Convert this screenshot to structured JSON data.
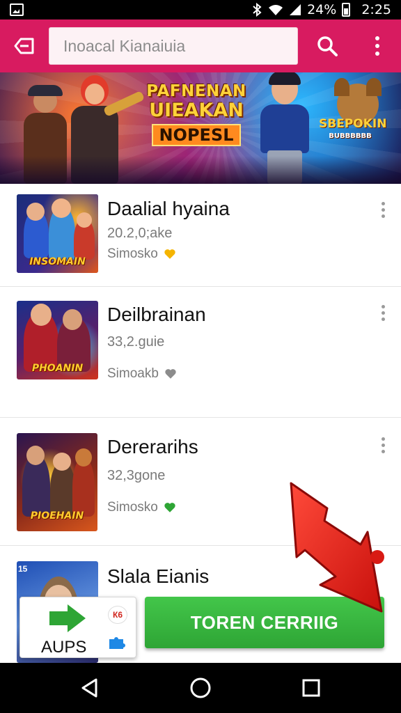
{
  "status_bar": {
    "battery_percent": "24%",
    "time": "2:25",
    "icons": [
      "image-icon",
      "bluetooth-icon",
      "wifi-icon",
      "signal-icon",
      "battery-icon"
    ]
  },
  "app_bar": {
    "background_color": "#d81b60",
    "search_placeholder": "Inoacal Kianaiuia",
    "icons": [
      "back-icon",
      "search-icon",
      "more-vert-icon"
    ]
  },
  "banner": {
    "title_line1": "PAFNENAN",
    "title_line2": "UIEAKAN",
    "title_line3": "NOPESL",
    "badge_title": "SBEPOKIN",
    "badge_subtitle": "BUBBBBBB",
    "page_count": 4
  },
  "list": {
    "items": [
      {
        "title": "Daalial hyaina",
        "meta": "20.2,0;ake",
        "sub": "Simosko",
        "thumb_caption": "INSOMAIN",
        "heart_color": "#f5b400",
        "icon": "heart-icon"
      },
      {
        "title": "Deilbrainan",
        "meta": "33,2.guie",
        "sub": "Simoakb",
        "thumb_caption": "PHOANIN",
        "heart_color": "#8c8c8c",
        "icon": "heart-icon"
      },
      {
        "title": "Dererarihs",
        "meta": "32,3gone",
        "sub": "Simosko",
        "thumb_caption": "PIOEHAIN",
        "heart_color": "#2ea535",
        "icon": "heart-icon"
      },
      {
        "title": "Slala Eianis",
        "thumb_corner": "15"
      }
    ]
  },
  "bottom": {
    "apps_label": "AUPS",
    "badge_text": "К6",
    "cta_label": "TOREN CERRIIG",
    "cta_color": "#2ea535"
  },
  "nav_bar": {
    "icons": [
      "nav-back-icon",
      "nav-home-icon",
      "nav-recents-icon"
    ]
  }
}
